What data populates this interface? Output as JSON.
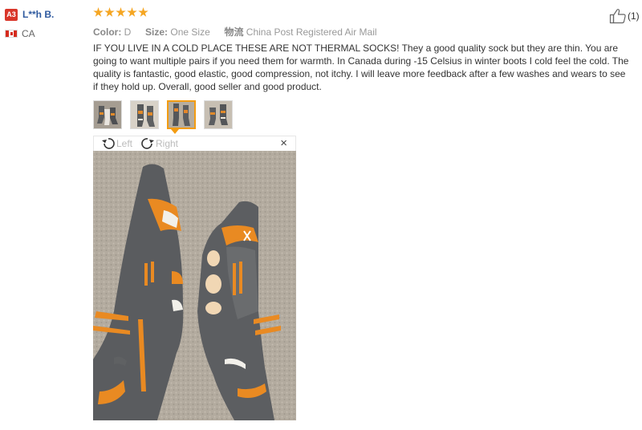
{
  "reviewer": {
    "badge": "A3",
    "name": "L**h B.",
    "country": "CA"
  },
  "rating": {
    "stars": 5,
    "out_of": 5
  },
  "helpful": {
    "count_label": "(1)"
  },
  "meta": {
    "color_label": "Color:",
    "color_value": "D",
    "size_label": "Size:",
    "size_value": "One Size",
    "shipping_label": "物流",
    "shipping_value": "China Post Registered Air Mail"
  },
  "review_text": "IF YOU LIVE IN A COLD PLACE THESE ARE NOT THERMAL SOCKS! They a good quality sock but they are thin. You are going to want multiple pairs if you need them for warmth. In Canada during -15 Celsius in winter boots I cold feel the cold. The quality is fantastic, good elastic, good compression, not itchy. I will leave more feedback after a few washes and wears to see if they hold up. Overall, good seller and good product.",
  "photos": {
    "count": 4,
    "active_index": 2
  },
  "viewer": {
    "rotate_left_label": "Left",
    "rotate_right_label": "Right",
    "close_glyph": "×"
  },
  "colors": {
    "accent": "#f39c12",
    "star": "#f5a623",
    "badge": "#d9362a",
    "name": "#2f5a9f"
  },
  "icons": {
    "thumbs_up": "thumbs-up-icon",
    "rotate_left": "rotate-left-icon",
    "rotate_right": "rotate-right-icon",
    "close": "close-icon",
    "flag": "canada-flag-icon",
    "star": "star-icon"
  }
}
